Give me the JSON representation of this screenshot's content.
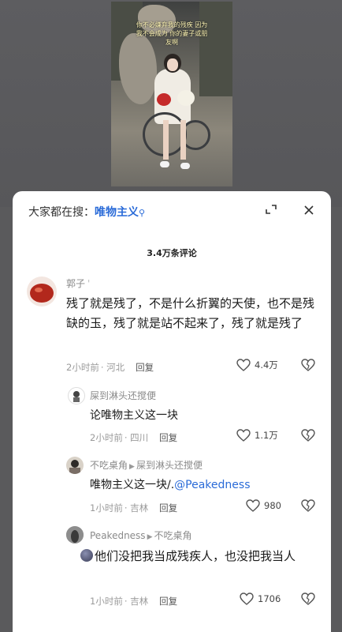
{
  "video": {
    "caption": "你不必嫌弃我的残疾 因为我不会成为 你的妻子或朋友啊"
  },
  "search": {
    "prefix": "大家都在搜：",
    "keyword": "唯物主义",
    "mag": "ℴ"
  },
  "comments_count": "3.4万条评论",
  "comments": [
    {
      "user": "郭子",
      "user_mark": "'",
      "text": "残了就是残了，不是什么折翼的天使，也不是残缺的玉，残了就是站不起来了，残了就是残了",
      "time": "2小时前",
      "location": "河北",
      "reply_label": "回复",
      "likes": "4.4万"
    },
    {
      "user": "屎到淋头还搅便",
      "text": "论唯物主义这一块",
      "time": "2小时前",
      "location": "四川",
      "reply_label": "回复",
      "likes": "1.1万"
    },
    {
      "user": "不吃桌角",
      "reply_to": "屎到淋头还搅便",
      "text": "唯物主义这一块/.",
      "mention": "@Peakedness",
      "time": "1小时前",
      "location": "吉林",
      "reply_label": "回复",
      "likes": "980"
    },
    {
      "user": "Peakedness",
      "reply_to": "不吃桌角",
      "text": "他们没把我当成残疾人，也没把我当人",
      "time": "1小时前",
      "location": "吉林",
      "reply_label": "回复",
      "likes": "1706"
    }
  ],
  "icons": {
    "shrink": "shrink-icon",
    "close": "close-icon",
    "like": "heart-icon",
    "dislike": "broken-heart-icon"
  },
  "colors": {
    "accent": "#2a6bd8",
    "backdrop": "#5a5a5c"
  }
}
